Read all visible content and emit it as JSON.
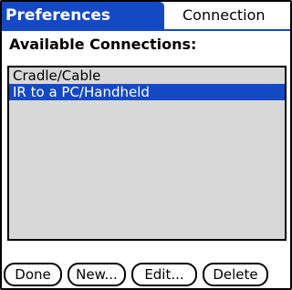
{
  "header": {
    "title": "Preferences",
    "category": "Connection"
  },
  "main": {
    "section_label": "Available Connections:",
    "connections": [
      {
        "label": "Cradle/Cable",
        "selected": false
      },
      {
        "label": "IR to a PC/Handheld",
        "selected": true
      }
    ]
  },
  "buttons": {
    "done": "Done",
    "new": "New...",
    "edit": "Edit...",
    "delete": "Delete"
  },
  "colors": {
    "accent": "#1549c4",
    "list_background": "#d8d8d8"
  }
}
